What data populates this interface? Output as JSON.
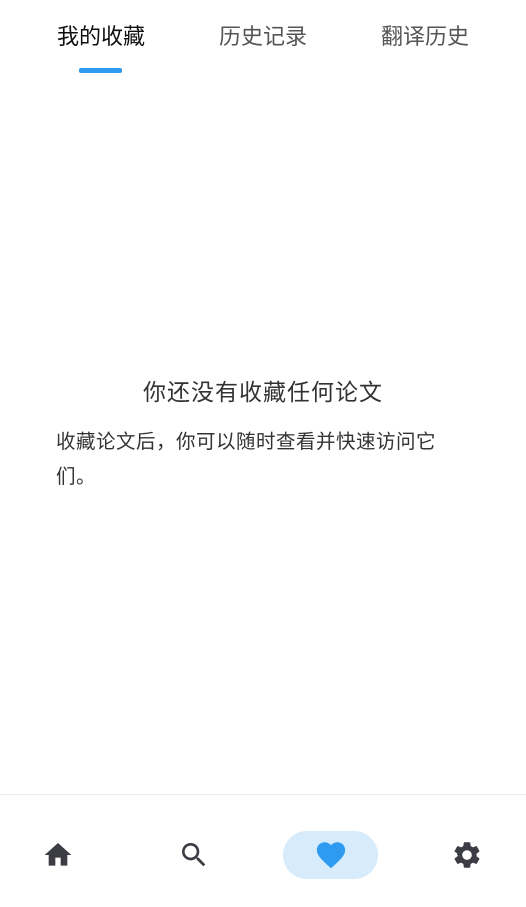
{
  "tabs": [
    {
      "label": "我的收藏",
      "active": true
    },
    {
      "label": "历史记录",
      "active": false
    },
    {
      "label": "翻译历史",
      "active": false
    }
  ],
  "empty_state": {
    "title": "你还没有收藏任何论文",
    "description": "收藏论文后，你可以随时查看并快速访问它们。"
  },
  "bottom_nav": {
    "items": [
      {
        "icon": "home-icon",
        "active": false
      },
      {
        "icon": "search-icon",
        "active": false
      },
      {
        "icon": "heart-icon",
        "active": true
      },
      {
        "icon": "gear-icon",
        "active": false
      }
    ]
  },
  "colors": {
    "accent": "#2f9bf0",
    "accent_bg": "#d6ebfc",
    "icon_inactive": "#3c3c44"
  }
}
